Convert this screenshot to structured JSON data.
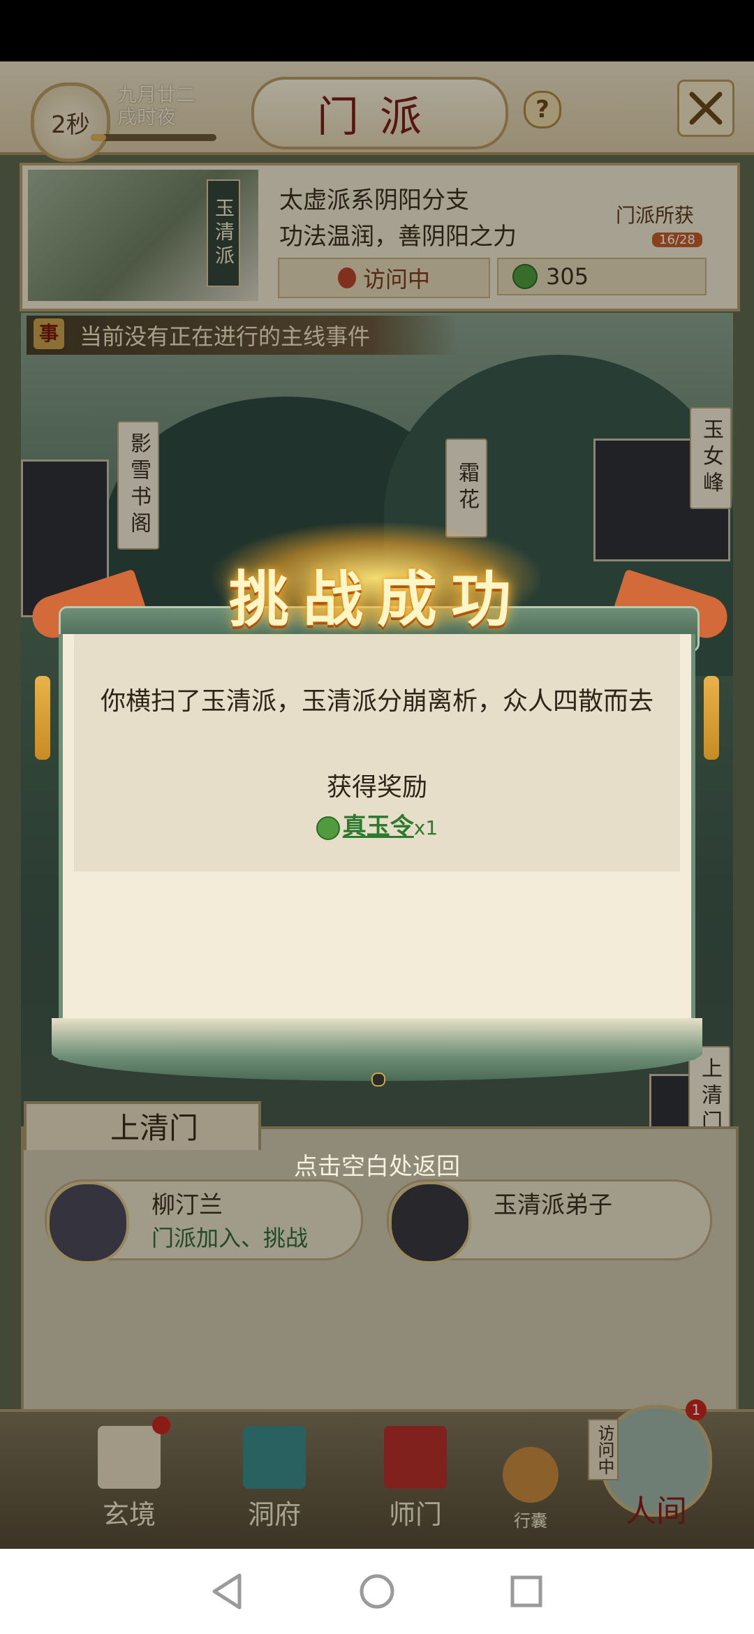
{
  "header": {
    "timer": "2秒",
    "date_line1": "九月廿二",
    "date_line2": "戌时夜",
    "time_progress": 0.12,
    "title": "门派",
    "help_label": "?"
  },
  "sect": {
    "banner": "玉清派",
    "desc_line1": "太虚派系阴阳分支",
    "desc_line2": "功法温润，善阴阳之力",
    "loot_title": "门派所获",
    "loot_count": "16/28",
    "visit_status": "访问中",
    "token_count": "305"
  },
  "map": {
    "event_banner": "当前没有正在进行的主线事件",
    "event_icon": "事",
    "signs": [
      "影雪书阁",
      "霜花",
      "玉女峰",
      "上清门"
    ]
  },
  "modal": {
    "title": "挑战成功",
    "message": "你横扫了玉清派，玉清派分崩离析，众人四散而去",
    "reward_heading": "获得奖励",
    "reward_item": "真玉令",
    "reward_qty": "x1"
  },
  "return_hint": "点击空白处返回",
  "bottom_panel": {
    "tab_label": "上清门",
    "npcs": [
      {
        "name": "柳汀兰",
        "sub": "门派加入、挑战"
      },
      {
        "name": "玉清派弟子",
        "sub": ""
      }
    ]
  },
  "bottom_nav": {
    "items": [
      {
        "label": "玄境"
      },
      {
        "label": "洞府"
      },
      {
        "label": "师门"
      },
      {
        "label": "行囊"
      },
      {
        "label": "人间"
      }
    ],
    "visit_tag": "访问中",
    "notification_count": "1"
  },
  "colors": {
    "accent_red": "#7c2018",
    "reward_green": "#2c7a2f",
    "scroll_green": "#6f8f77"
  }
}
